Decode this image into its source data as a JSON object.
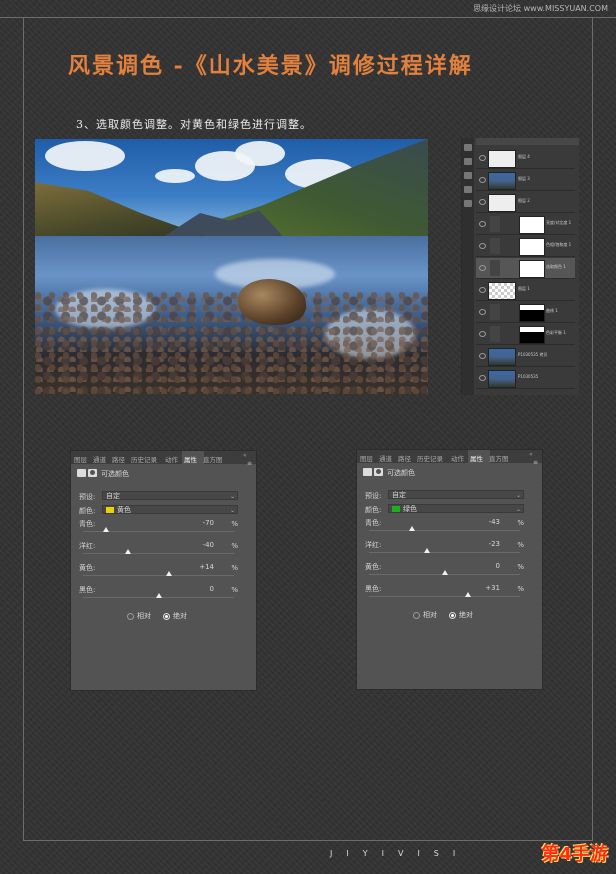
{
  "watermark_top": "思缘设计论坛 www.MISSYUAN.COM",
  "page_title": "风景调色 -《山水美景》调修过程详解",
  "step_text": "3、选取颜色调整。对黄色和绿色进行调整。",
  "layers_panel": {
    "layers": [
      {
        "name": "图层 4",
        "thumb": "white"
      },
      {
        "name": "图层 3",
        "thumb": "photo"
      },
      {
        "name": "图层 2",
        "thumb": "white"
      },
      {
        "name": "亮度/对比度 1",
        "thumb": "adj"
      },
      {
        "name": "色相/饱和度 1",
        "thumb": "adj"
      },
      {
        "name": "选取颜色 1",
        "thumb": "adj",
        "selected": true
      },
      {
        "name": "图层 1",
        "thumb": "check"
      },
      {
        "name": "曲线 1",
        "thumb": "adj"
      },
      {
        "name": "色彩平衡 1",
        "thumb": "adj"
      },
      {
        "name": "P1030535 拷贝",
        "thumb": "photo"
      },
      {
        "name": "P1030535",
        "thumb": "photo"
      }
    ]
  },
  "panel_tabs": [
    "图层",
    "通道",
    "路径",
    "历史记录",
    "动作",
    "属性",
    "直方图"
  ],
  "active_tab": "属性",
  "collapse_glyph": "«",
  "menu_glyph": "≡",
  "panel_header_title": "可选颜色",
  "labels": {
    "preset": "预设:",
    "colors": "颜色:",
    "cyan": "青色:",
    "magenta": "洋红:",
    "yellow": "黄色:",
    "black": "黑色:",
    "relative": "相对",
    "absolute": "绝对",
    "percent": "%"
  },
  "panels": [
    {
      "preset": "自定",
      "color_name": "黄色",
      "color_hex": "#e8d400",
      "cyan": "-70",
      "magenta": "-40",
      "yellow": "+14",
      "black": "0",
      "cyan_pos": 0.15,
      "magenta_pos": 0.3,
      "yellow_pos": 0.57,
      "black_pos": 0.5,
      "method": "absolute"
    },
    {
      "preset": "自定",
      "color_name": "绿色",
      "color_hex": "#1fae1f",
      "cyan": "-43",
      "magenta": "-23",
      "yellow": "0",
      "black": "+31",
      "cyan_pos": 0.285,
      "magenta_pos": 0.385,
      "yellow_pos": 0.5,
      "black_pos": 0.655,
      "method": "absolute"
    }
  ],
  "footer_brand": "JIYIVISI",
  "footer_logo": "第4手游",
  "colors": {
    "title_orange": "#e1813d",
    "background": "#333333",
    "panel_gray": "#535353"
  }
}
